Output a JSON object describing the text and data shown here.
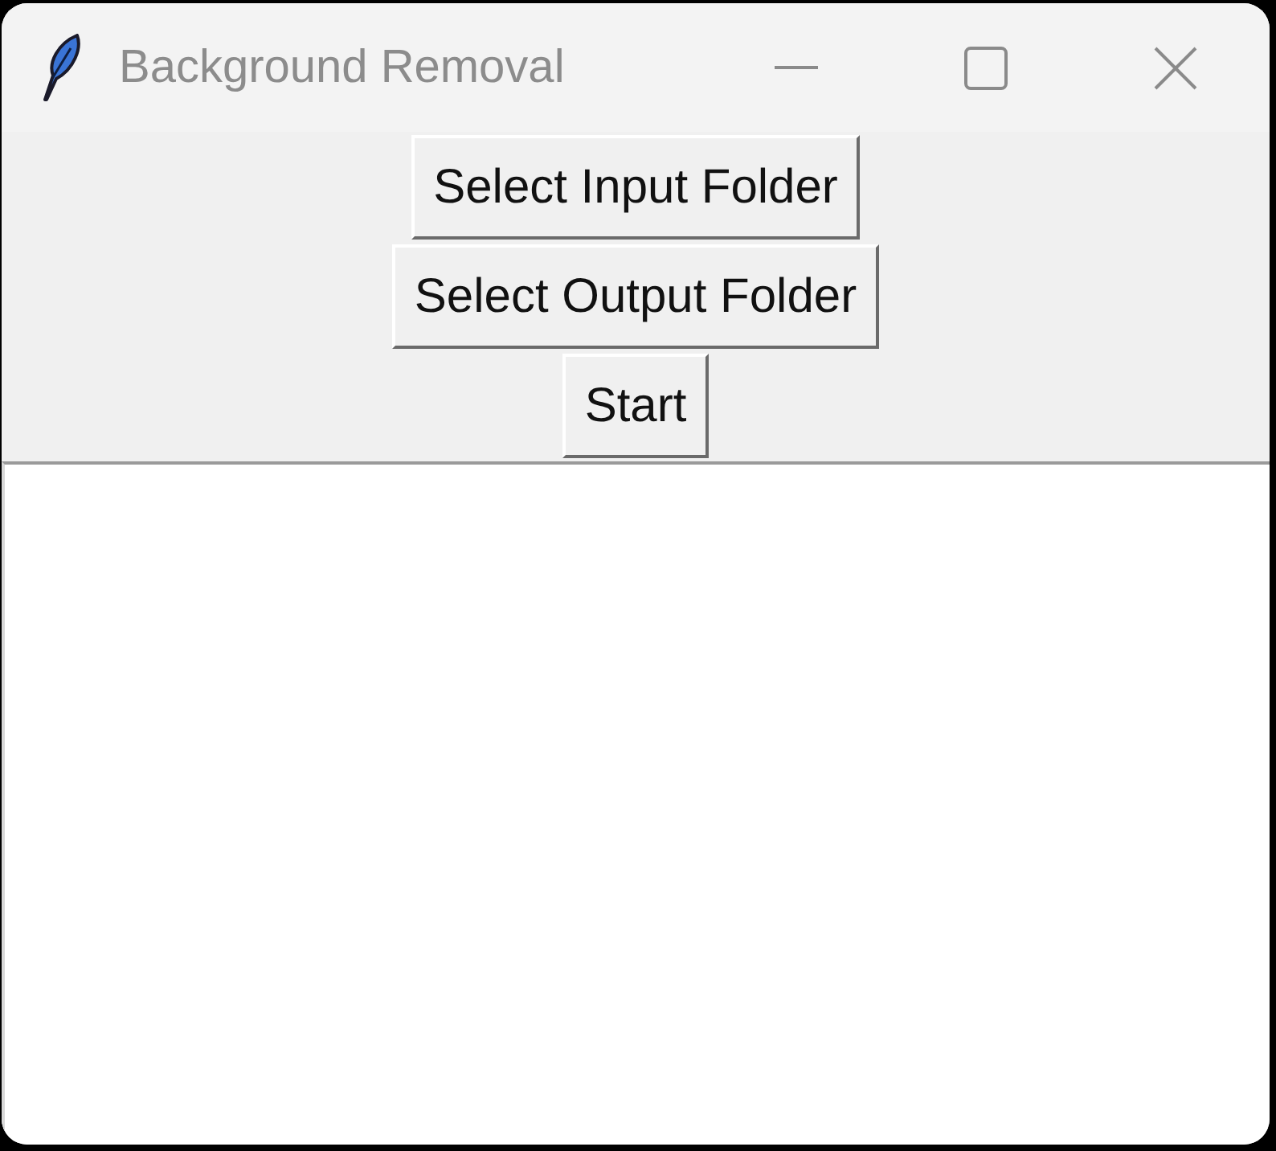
{
  "window": {
    "title": "Background Removal"
  },
  "buttons": [
    {
      "label": "Select Input Folder"
    },
    {
      "label": "Select Output Folder"
    },
    {
      "label": "Start"
    }
  ]
}
